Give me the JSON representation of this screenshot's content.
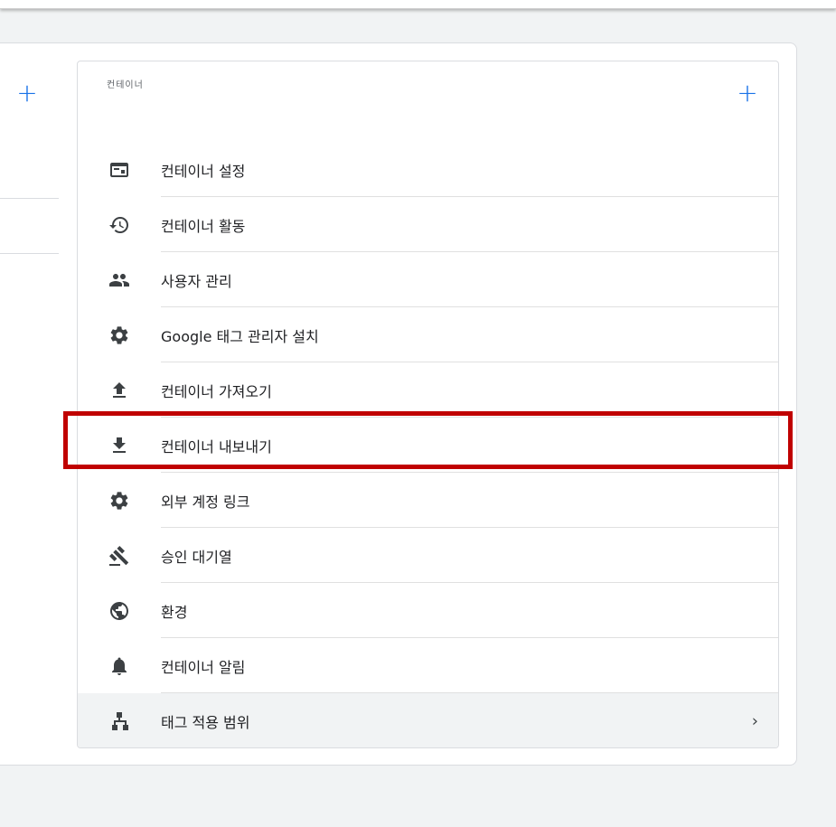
{
  "left_panel": {
    "plus_label": "+"
  },
  "container_card": {
    "title": "컨테이너",
    "plus_label": "+",
    "items": [
      {
        "label": "컨테이너 설정",
        "icon": "web-asset-icon"
      },
      {
        "label": "컨테이너 활동",
        "icon": "history-icon"
      },
      {
        "label": "사용자 관리",
        "icon": "people-icon"
      },
      {
        "label": "Google 태그 관리자 설치",
        "icon": "gear-icon"
      },
      {
        "label": "컨테이너 가져오기",
        "icon": "upload-icon"
      },
      {
        "label": "컨테이너 내보내기",
        "icon": "download-icon"
      },
      {
        "label": "외부 계정 링크",
        "icon": "gear-icon"
      },
      {
        "label": "승인 대기열",
        "icon": "gavel-icon"
      },
      {
        "label": "환경",
        "icon": "globe-icon"
      },
      {
        "label": "컨테이너 알림",
        "icon": "bell-icon"
      },
      {
        "label": "태그 적용 범위",
        "icon": "sitemap-icon",
        "chevron": "›"
      }
    ]
  },
  "colors": {
    "accent": "#1a73e8",
    "highlight_border": "#c00000"
  }
}
